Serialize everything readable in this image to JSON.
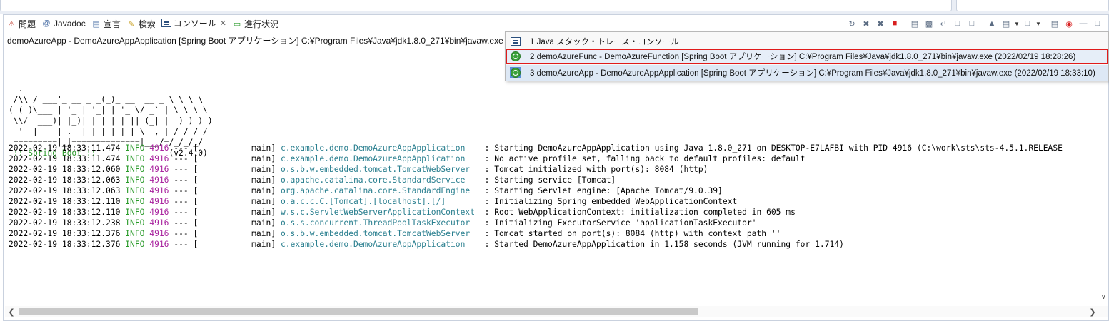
{
  "tabs": [
    {
      "label": "問題",
      "icon": "problems-icon"
    },
    {
      "label": "Javadoc",
      "icon": "javadoc-icon"
    },
    {
      "label": "宣言",
      "icon": "declaration-icon"
    },
    {
      "label": "検索",
      "icon": "search-icon"
    },
    {
      "label": "コンソール",
      "icon": "console-icon",
      "active": true
    },
    {
      "label": "進行状況",
      "icon": "progress-icon"
    }
  ],
  "process_label": "demoAzureApp - DemoAzureAppApplication [Spring Boot アプリケーション] C:¥Program Files¥Java¥jdk1.8.0_271¥bin¥javaw.exe (2022/02/",
  "banner": {
    "lines": [
      "  .   ____          _            __ _ _",
      " /\\\\ / ___'_ __ _ _(_)_ __  __ _ \\ \\ \\ \\",
      "( ( )\\___ | '_ | '_| | '_ \\/ _` | \\ \\ \\ \\",
      " \\\\/  ___)| |_)| | | | | || (_| |  ) ) ) )",
      "  '  |____| .__|_| |_|_| |_\\__, | / / / /",
      " =========|_|==============|___/=/_/_/_/"
    ],
    "boot_label": " :: Spring Boot :: ",
    "version": "              (v2.4.0)"
  },
  "logs": [
    {
      "ts": "2022-02-19 18:33:11.474",
      "level": "INFO",
      "pid": "4916",
      "sep": " --- [           main] ",
      "logger": "c.example.demo.DemoAzureAppApplication   ",
      "msg": " : Starting DemoAzureAppApplication using Java 1.8.0_271 on DESKTOP-E7LAFBI with PID 4916 (C:\\work\\sts\\sts-4.5.1.RELEASE"
    },
    {
      "ts": "2022-02-19 18:33:11.474",
      "level": "INFO",
      "pid": "4916",
      "sep": " --- [           main] ",
      "logger": "c.example.demo.DemoAzureAppApplication   ",
      "msg": " : No active profile set, falling back to default profiles: default"
    },
    {
      "ts": "2022-02-19 18:33:12.060",
      "level": "INFO",
      "pid": "4916",
      "sep": " --- [           main] ",
      "logger": "o.s.b.w.embedded.tomcat.TomcatWebServer  ",
      "msg": " : Tomcat initialized with port(s): 8084 (http)"
    },
    {
      "ts": "2022-02-19 18:33:12.063",
      "level": "INFO",
      "pid": "4916",
      "sep": " --- [           main] ",
      "logger": "o.apache.catalina.core.StandardService   ",
      "msg": " : Starting service [Tomcat]"
    },
    {
      "ts": "2022-02-19 18:33:12.063",
      "level": "INFO",
      "pid": "4916",
      "sep": " --- [           main] ",
      "logger": "org.apache.catalina.core.StandardEngine  ",
      "msg": " : Starting Servlet engine: [Apache Tomcat/9.0.39]"
    },
    {
      "ts": "2022-02-19 18:33:12.110",
      "level": "INFO",
      "pid": "4916",
      "sep": " --- [           main] ",
      "logger": "o.a.c.c.C.[Tomcat].[localhost].[/]       ",
      "msg": " : Initializing Spring embedded WebApplicationContext"
    },
    {
      "ts": "2022-02-19 18:33:12.110",
      "level": "INFO",
      "pid": "4916",
      "sep": " --- [           main] ",
      "logger": "w.s.c.ServletWebServerApplicationContext ",
      "msg": " : Root WebApplicationContext: initialization completed in 605 ms"
    },
    {
      "ts": "2022-02-19 18:33:12.238",
      "level": "INFO",
      "pid": "4916",
      "sep": " --- [           main] ",
      "logger": "o.s.s.concurrent.ThreadPoolTaskExecutor  ",
      "msg": " : Initializing ExecutorService 'applicationTaskExecutor'"
    },
    {
      "ts": "2022-02-19 18:33:12.376",
      "level": "INFO",
      "pid": "4916",
      "sep": " --- [           main] ",
      "logger": "o.s.b.w.embedded.tomcat.TomcatWebServer  ",
      "msg": " : Tomcat started on port(s): 8084 (http) with context path ''"
    },
    {
      "ts": "2022-02-19 18:33:12.376",
      "level": "INFO",
      "pid": "4916",
      "sep": " --- [           main] ",
      "logger": "c.example.demo.DemoAzureAppApplication   ",
      "msg": " : Started DemoAzureAppApplication in 1.158 seconds (JVM running for 1.714)"
    }
  ],
  "dropdown": {
    "items": [
      {
        "label": "1 Java スタック・トレース・コンソール",
        "icon": "console-icon"
      },
      {
        "label": "2 demoAzureFunc - DemoAzureFunction [Spring Boot アプリケーション] C:¥Program Files¥Java¥jdk1.8.0_271¥bin¥javaw.exe (2022/02/19 18:28:26)",
        "icon": "spring-boot-icon",
        "selected": true
      },
      {
        "label": "3 demoAzureApp - DemoAzureAppApplication [Spring Boot アプリケーション] C:¥Program Files¥Java¥jdk1.8.0_271¥bin¥javaw.exe (2022/02/19 18:33:10)",
        "icon": "spring-boot-icon",
        "current": true
      }
    ]
  },
  "colors": {
    "info": "#2a9a2a",
    "pid": "#a8229e",
    "logger": "#2a7f8f",
    "highlight_border": "#e01b1b"
  }
}
